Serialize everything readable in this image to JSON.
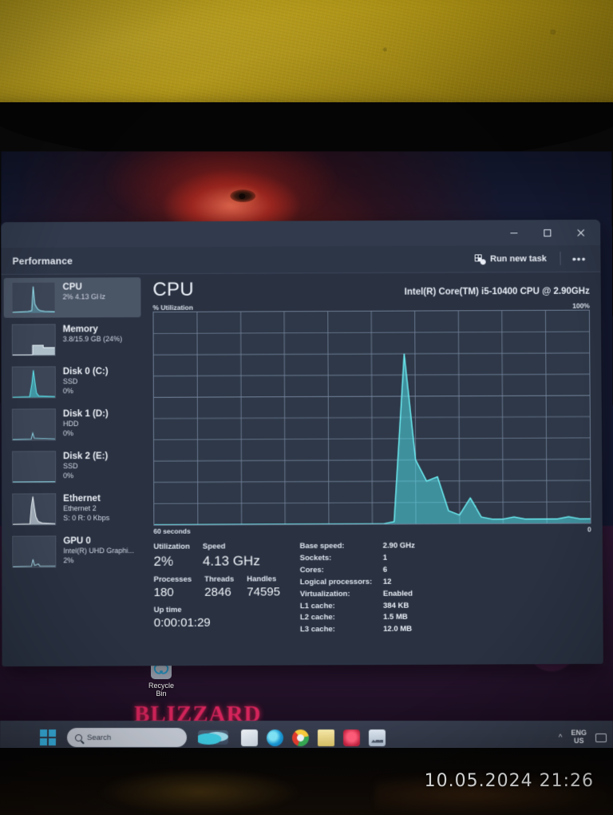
{
  "photo": {
    "timestamp": "10.05.2024  21:26"
  },
  "desktop": {
    "recycle_bin_label": "Recycle Bin",
    "wallpaper_text": "BLIZZARD"
  },
  "taskbar": {
    "search_placeholder": "Search",
    "language": "ENG",
    "language_region": "US",
    "icons": [
      {
        "name": "weather-widget"
      },
      {
        "name": "microsoft-store"
      },
      {
        "name": "microsoft-edge"
      },
      {
        "name": "google-chrome"
      },
      {
        "name": "file-explorer"
      },
      {
        "name": "red-app"
      },
      {
        "name": "task-manager"
      }
    ]
  },
  "window": {
    "title": "Performance",
    "run_new_task_label": "Run new task",
    "more_options_label": "•••",
    "minimize_label": "—",
    "maximize_label": "☐",
    "close_label": "✕"
  },
  "sidebar": {
    "items": [
      {
        "name": "CPU",
        "line1": "2% 4.13 GHz",
        "line2": "",
        "active": true
      },
      {
        "name": "Memory",
        "line1": "3.8/15.9 GB (24%)",
        "line2": "",
        "active": false
      },
      {
        "name": "Disk 0 (C:)",
        "line1": "SSD",
        "line2": "0%",
        "active": false
      },
      {
        "name": "Disk 1 (D:)",
        "line1": "HDD",
        "line2": "0%",
        "active": false
      },
      {
        "name": "Disk 2 (E:)",
        "line1": "SSD",
        "line2": "0%",
        "active": false
      },
      {
        "name": "Ethernet",
        "line1": "Ethernet 2",
        "line2": "S: 0 R: 0 Kbps",
        "active": false
      },
      {
        "name": "GPU 0",
        "line1": "Intel(R) UHD Graphi...",
        "line2": "2%",
        "active": false
      }
    ]
  },
  "main": {
    "heading": "CPU",
    "cpu_model": "Intel(R) Core(TM) i5-10400 CPU @ 2.90GHz",
    "graph_y_label": "% Utilization",
    "graph_y_max": "100%",
    "graph_x_left": "60 seconds",
    "graph_x_right": "0",
    "stats": {
      "utilization_label": "Utilization",
      "utilization_value": "2%",
      "speed_label": "Speed",
      "speed_value": "4.13 GHz",
      "processes_label": "Processes",
      "processes_value": "180",
      "threads_label": "Threads",
      "threads_value": "2846",
      "handles_label": "Handles",
      "handles_value": "74595",
      "uptime_label": "Up time",
      "uptime_value": "0:00:01:29"
    },
    "details": [
      {
        "key": "Base speed:",
        "value": "2.90 GHz"
      },
      {
        "key": "Sockets:",
        "value": "1"
      },
      {
        "key": "Cores:",
        "value": "6"
      },
      {
        "key": "Logical processors:",
        "value": "12"
      },
      {
        "key": "Virtualization:",
        "value": "Enabled"
      },
      {
        "key": "L1 cache:",
        "value": "384 KB"
      },
      {
        "key": "L2 cache:",
        "value": "1.5 MB"
      },
      {
        "key": "L3 cache:",
        "value": "12.0 MB"
      }
    ]
  },
  "chart_data": {
    "type": "area",
    "title": "% Utilization",
    "xlabel": "60 seconds",
    "ylabel": "% Utilization",
    "ylim": [
      0,
      100
    ],
    "xlim": [
      0,
      60
    ],
    "grid": true,
    "accent_color": "#55e0e8",
    "fill_color": "#46c8d8",
    "background_color": "#2e3848",
    "x": [
      0,
      2,
      4,
      6,
      8,
      10,
      12,
      14,
      16,
      18,
      20,
      22,
      24,
      26,
      28,
      30,
      32,
      34,
      36,
      38,
      40,
      42,
      44,
      46,
      48,
      50,
      52,
      54,
      56,
      58,
      60
    ],
    "values": [
      0,
      0,
      0,
      0,
      0,
      0,
      0,
      0,
      0,
      0,
      0,
      0,
      0,
      0,
      0,
      0,
      0,
      0,
      0,
      0,
      0,
      0,
      1,
      80,
      30,
      20,
      22,
      6,
      4,
      12,
      3,
      2,
      2,
      3,
      2,
      2,
      2,
      2,
      3,
      2,
      2
    ]
  }
}
